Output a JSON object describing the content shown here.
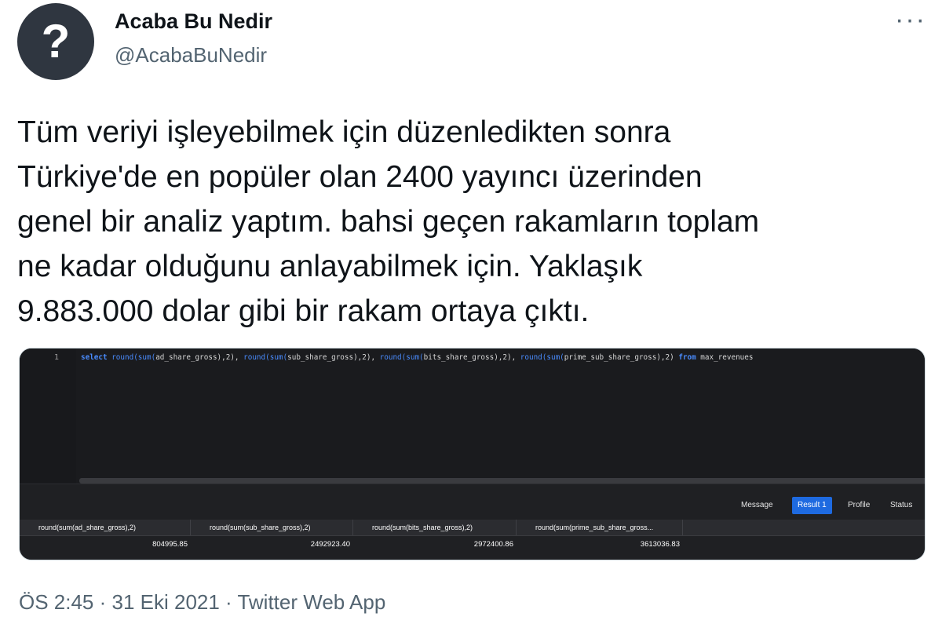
{
  "author": {
    "display_name": "Acaba Bu Nedir",
    "handle": "@AcabaBuNedir",
    "avatar_symbol": "?",
    "avatar_color": "#2f3640"
  },
  "menu": {
    "more_icon": "···"
  },
  "tweet": {
    "text": "Tüm veriyi işleyebilmek için düzenledikten sonra\nTürkiye'de en popüler olan 2400 yayıncı üzerinden\ngenel bir analiz yaptım. bahsi geçen rakamların toplam\nne kadar olduğunu anlayabilmek için. Yaklaşık\n9.883.000 dolar gibi bir rakam ortaya çıktı."
  },
  "screenshot": {
    "line_number": "1",
    "query": {
      "kw_select": "select",
      "fn1": "round(sum(",
      "arg1": "ad_share_gross),2), ",
      "fn2": "round(sum(",
      "arg2": "sub_share_gross),2), ",
      "fn3": "round(sum(",
      "arg3": "bits_share_gross),2), ",
      "fn4": "round(sum(",
      "arg4": "prime_sub_share_gross),2) ",
      "kw_from": "from",
      "table": " max_revenues"
    },
    "tabs": [
      {
        "label": "Message",
        "active": false
      },
      {
        "label": "Result 1",
        "active": true
      },
      {
        "label": "Profile",
        "active": false
      },
      {
        "label": "Status",
        "active": false
      }
    ],
    "columns": [
      "round(sum(ad_share_gross),2)",
      "round(sum(sub_share_gross),2)",
      "round(sum(bits_share_gross),2)",
      "round(sum(prime_sub_share_gross..."
    ],
    "row": [
      "804995.85",
      "2492923.40",
      "2972400.86",
      "3613036.83"
    ],
    "accent_color": "#1e6ae0"
  },
  "meta": {
    "timestamp": "ÖS 2:45 · 31 Eki 2021 · Twitter Web App"
  }
}
